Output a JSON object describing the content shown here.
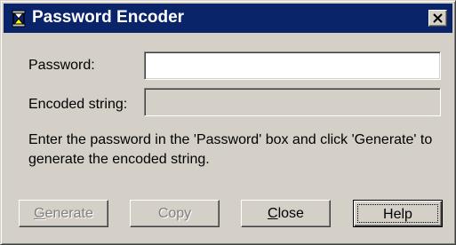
{
  "window": {
    "title": "Password Encoder",
    "icon": "hourglass-tripod-icon",
    "close_icon": "close-x-icon"
  },
  "form": {
    "password_label": "Password:",
    "password_value": "",
    "encoded_label": "Encoded string:",
    "encoded_value": ""
  },
  "instructions": "Enter the password in the 'Password' box and click 'Generate' to generate the encoded string.",
  "buttons": {
    "generate": {
      "accel": "G",
      "rest": "enerate",
      "enabled": false
    },
    "copy": {
      "label": "Copy",
      "enabled": false
    },
    "close": {
      "accel": "C",
      "rest": "lose",
      "enabled": true
    },
    "help": {
      "label": "Help",
      "enabled": true,
      "default": true
    }
  },
  "colors": {
    "title_bar": "#0a246a",
    "face": "#d4d0c8",
    "disabled_text": "#808080"
  }
}
